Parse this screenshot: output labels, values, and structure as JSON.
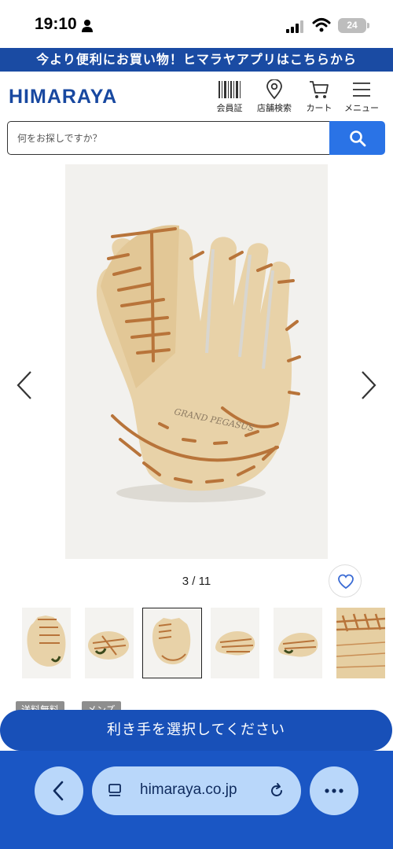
{
  "status_bar": {
    "time": "19:10",
    "battery": "24"
  },
  "app_banner": {
    "text": "今より便利にお買い物！ヒマラヤアプリはこちらから"
  },
  "header": {
    "logo": "HIMARAYA",
    "member_card_label": "会員証",
    "store_search_label": "店舗検索",
    "cart_label": "カート",
    "menu_label": "メニュー"
  },
  "search": {
    "placeholder": "何をお探しですか？"
  },
  "carousel": {
    "counter": "3 / 11",
    "total_images": 11,
    "current_index": 3,
    "logo_text": "GRAND PEGASUS"
  },
  "tags": [
    "送料無料",
    "メンズ"
  ],
  "cta": {
    "select_hand": "利き手を選択してください"
  },
  "browser": {
    "url": "himaraya.co.jp"
  },
  "colors": {
    "brand_blue": "#1848a0",
    "search_blue": "#2a73e6",
    "cta_blue": "#1850b8",
    "glove_tan": "#e8d2a8",
    "lace_brown": "#b8743a"
  }
}
